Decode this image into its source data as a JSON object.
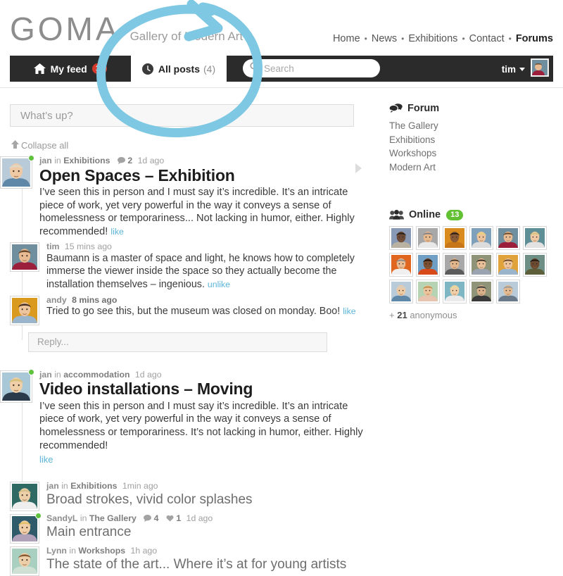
{
  "header": {
    "logo": "GOMA",
    "tagline": "Gallery of Modern Art",
    "nav": [
      {
        "label": "Home",
        "active": false
      },
      {
        "label": "News",
        "active": false
      },
      {
        "label": "Exhibitions",
        "active": false
      },
      {
        "label": "Contact",
        "active": false
      },
      {
        "label": "Forums",
        "active": true
      }
    ],
    "separator": "•"
  },
  "tabs": {
    "my_feed": {
      "label": "My feed",
      "badge": "13",
      "icon": "home-icon"
    },
    "all_posts": {
      "label": "All posts",
      "count": "(4)",
      "icon": "clock-icon",
      "active": true
    }
  },
  "search": {
    "placeholder": "Search",
    "value": "",
    "icon": "search-icon"
  },
  "user": {
    "name": "tim",
    "avatar": "user-avatar"
  },
  "composer": {
    "placeholder": "What’s up?",
    "value": ""
  },
  "collapse_all": {
    "label": "Collapse all",
    "icon": "arrow-up-icon"
  },
  "posts": [
    {
      "author": "jan",
      "in_word": "in",
      "forum": "Exhibitions",
      "time": "1d ago",
      "comment_count": "2",
      "online": true,
      "title": "Open Spaces – Exhibition",
      "body": "I’ve seen this in person and I must say it’s incredible. It’s an intricate piece of work, yet very powerful in the way it conveys a sense of homelessness or temporariness... Not lacking in humor, either. Highly recommended!",
      "like_label": "like",
      "replies": [
        {
          "author": "tim",
          "time": "15 mins ago",
          "time_bold": false,
          "body": "Baumann is a master of space and light, he knows how to completely immerse the viewer inside the space so they actually become the installation themselves – ingenious.",
          "like_label": "unlike"
        },
        {
          "author": "andy",
          "time": "8 mins ago",
          "time_bold": true,
          "body": "Tried to go see this, but the museum was closed on monday. Boo!",
          "like_label": "like"
        }
      ],
      "reply_placeholder": "Reply..."
    },
    {
      "author": "jan",
      "in_word": "in",
      "forum": "accommodation",
      "time": "1d ago",
      "comment_count": "",
      "online": true,
      "title": "Video installations – Moving",
      "body": "I’ve seen this in person and I must say it’s incredible. It’s an intricate piece of work, yet very powerful in the way it conveys a sense of homelessness or temporariness. It’s not lacking in humor, either. Highly recommended!",
      "like_label": "like",
      "replies": [],
      "reply_placeholder": ""
    }
  ],
  "compact_posts": [
    {
      "author": "jan",
      "in_word": "in",
      "forum": "Exhibitions",
      "time": "1min ago",
      "comment_count": "",
      "heart_count": "",
      "online": false,
      "title": "Broad strokes, vivid color splashes"
    },
    {
      "author": "SandyL",
      "in_word": "in",
      "forum": "The Gallery",
      "time": "1d ago",
      "comment_count": "4",
      "heart_count": "1",
      "online": true,
      "title": "Main entrance"
    },
    {
      "author": "Lynn",
      "in_word": "in",
      "forum": "Workshops",
      "time": "1h ago",
      "comment_count": "",
      "heart_count": "",
      "online": false,
      "title": "The state of the art... Where it’s at for young artists"
    }
  ],
  "sidebar": {
    "forum": {
      "title": "Forum",
      "icon": "speech-bubbles-icon",
      "items": [
        {
          "label": "The Gallery"
        },
        {
          "label": "Exhibitions"
        },
        {
          "label": "Workshops"
        },
        {
          "label": "Modern Art"
        }
      ]
    },
    "online": {
      "title": "Online",
      "icon": "people-icon",
      "count": "13",
      "anonymous_prefix": "+",
      "anonymous_count": "21",
      "anonymous_suffix": "anonymous",
      "avatars": [
        {
          "name": "online-avatar-1",
          "bg": "#8899b5",
          "skin": "#6b4a38",
          "hair": "#2b2118",
          "shirt": "#b9b2a2"
        },
        {
          "name": "online-avatar-2",
          "bg": "#a8a8a8",
          "skin": "#e6b98f",
          "hair": "#7f7f7f",
          "shirt": "#e8e8e8"
        },
        {
          "name": "online-avatar-3",
          "bg": "#d98b1e",
          "skin": "#8a5a36",
          "hair": "#2a1d12",
          "shirt": "#c8761a"
        },
        {
          "name": "online-avatar-4",
          "bg": "#7fa0bb",
          "skin": "#edc49c",
          "hair": "#e8d27a",
          "shirt": "#dcdcdc"
        },
        {
          "name": "online-avatar-5",
          "bg": "#6f8f9e",
          "skin": "#e8bb93",
          "hair": "#6b4a2c",
          "shirt": "#9b1f3a"
        },
        {
          "name": "online-avatar-6",
          "bg": "#5f8f96",
          "skin": "#efc9a4",
          "hair": "#d8c37e",
          "shirt": "#e2e2e2"
        },
        {
          "name": "online-avatar-7",
          "bg": "#e0661f",
          "skin": "#e8bb93",
          "hair": "#8a8a8a",
          "shirt": "#f0f0f0"
        },
        {
          "name": "online-avatar-8",
          "bg": "#6f9fc4",
          "skin": "#7a4e2e",
          "hair": "#1d1410",
          "shirt": "#d94a1a"
        },
        {
          "name": "online-avatar-9",
          "bg": "#a8a8a8",
          "skin": "#e3b78e",
          "hair": "#4a3a2a",
          "shirt": "#5c5c5c"
        },
        {
          "name": "online-avatar-10",
          "bg": "#8f9378",
          "skin": "#e8c09a",
          "hair": "#3a2b20",
          "shirt": "#9aa3b0"
        },
        {
          "name": "online-avatar-11",
          "bg": "#e0a23a",
          "skin": "#edc49c",
          "hair": "#6b4a2c",
          "shirt": "#9ab4cc"
        },
        {
          "name": "online-avatar-12",
          "bg": "#6d8f86",
          "skin": "#6b4a30",
          "hair": "#201814",
          "shirt": "#5c5f3a"
        },
        {
          "name": "online-avatar-13",
          "bg": "#b9cbd8",
          "skin": "#edc9a4",
          "hair": "#d8cfc0",
          "shirt": "#5f87a8"
        },
        {
          "name": "online-avatar-14",
          "bg": "#b6d4b4",
          "skin": "#edc49c",
          "hair": "#c08a4a",
          "shirt": "#e8c4b0"
        },
        {
          "name": "online-avatar-15",
          "bg": "#7fb6c4",
          "skin": "#f0cfa8",
          "hair": "#e4d89a",
          "shirt": "#eaeaea"
        },
        {
          "name": "online-avatar-16",
          "bg": "#8f9378",
          "skin": "#d8b08a",
          "hair": "#3a3a3a",
          "shirt": "#3a3a3a"
        },
        {
          "name": "online-avatar-17",
          "bg": "#b9cbd8",
          "skin": "#e3bb93",
          "hair": "#9a9a9a",
          "shirt": "#6a7a8a"
        }
      ]
    }
  },
  "annotation": {
    "shape": "circle-arrow",
    "color": "#7ec8e3"
  },
  "colors": {
    "dark_bar": "#2b2b2b",
    "accent_red": "#d33a2c",
    "accent_green": "#62c033",
    "link_blue": "#5bb4d6",
    "annotation_blue": "#7ec8e3"
  }
}
